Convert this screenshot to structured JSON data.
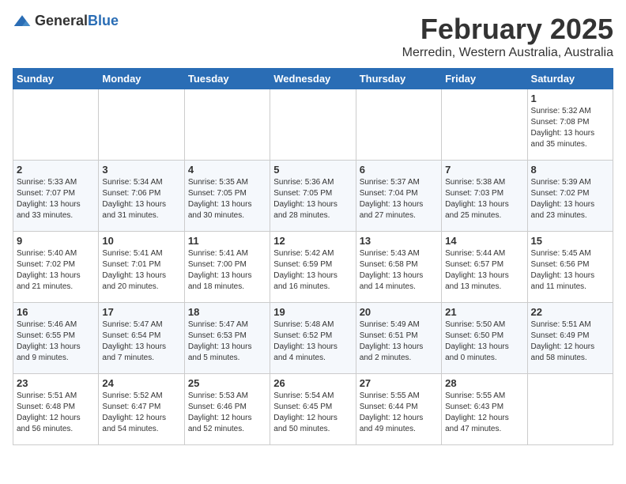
{
  "logo": {
    "text_general": "General",
    "text_blue": "Blue"
  },
  "title": "February 2025",
  "location": "Merredin, Western Australia, Australia",
  "headers": [
    "Sunday",
    "Monday",
    "Tuesday",
    "Wednesday",
    "Thursday",
    "Friday",
    "Saturday"
  ],
  "weeks": [
    [
      {
        "day": "",
        "info": ""
      },
      {
        "day": "",
        "info": ""
      },
      {
        "day": "",
        "info": ""
      },
      {
        "day": "",
        "info": ""
      },
      {
        "day": "",
        "info": ""
      },
      {
        "day": "",
        "info": ""
      },
      {
        "day": "1",
        "info": "Sunrise: 5:32 AM\nSunset: 7:08 PM\nDaylight: 13 hours and 35 minutes."
      }
    ],
    [
      {
        "day": "2",
        "info": "Sunrise: 5:33 AM\nSunset: 7:07 PM\nDaylight: 13 hours and 33 minutes."
      },
      {
        "day": "3",
        "info": "Sunrise: 5:34 AM\nSunset: 7:06 PM\nDaylight: 13 hours and 31 minutes."
      },
      {
        "day": "4",
        "info": "Sunrise: 5:35 AM\nSunset: 7:05 PM\nDaylight: 13 hours and 30 minutes."
      },
      {
        "day": "5",
        "info": "Sunrise: 5:36 AM\nSunset: 7:05 PM\nDaylight: 13 hours and 28 minutes."
      },
      {
        "day": "6",
        "info": "Sunrise: 5:37 AM\nSunset: 7:04 PM\nDaylight: 13 hours and 27 minutes."
      },
      {
        "day": "7",
        "info": "Sunrise: 5:38 AM\nSunset: 7:03 PM\nDaylight: 13 hours and 25 minutes."
      },
      {
        "day": "8",
        "info": "Sunrise: 5:39 AM\nSunset: 7:02 PM\nDaylight: 13 hours and 23 minutes."
      }
    ],
    [
      {
        "day": "9",
        "info": "Sunrise: 5:40 AM\nSunset: 7:02 PM\nDaylight: 13 hours and 21 minutes."
      },
      {
        "day": "10",
        "info": "Sunrise: 5:41 AM\nSunset: 7:01 PM\nDaylight: 13 hours and 20 minutes."
      },
      {
        "day": "11",
        "info": "Sunrise: 5:41 AM\nSunset: 7:00 PM\nDaylight: 13 hours and 18 minutes."
      },
      {
        "day": "12",
        "info": "Sunrise: 5:42 AM\nSunset: 6:59 PM\nDaylight: 13 hours and 16 minutes."
      },
      {
        "day": "13",
        "info": "Sunrise: 5:43 AM\nSunset: 6:58 PM\nDaylight: 13 hours and 14 minutes."
      },
      {
        "day": "14",
        "info": "Sunrise: 5:44 AM\nSunset: 6:57 PM\nDaylight: 13 hours and 13 minutes."
      },
      {
        "day": "15",
        "info": "Sunrise: 5:45 AM\nSunset: 6:56 PM\nDaylight: 13 hours and 11 minutes."
      }
    ],
    [
      {
        "day": "16",
        "info": "Sunrise: 5:46 AM\nSunset: 6:55 PM\nDaylight: 13 hours and 9 minutes."
      },
      {
        "day": "17",
        "info": "Sunrise: 5:47 AM\nSunset: 6:54 PM\nDaylight: 13 hours and 7 minutes."
      },
      {
        "day": "18",
        "info": "Sunrise: 5:47 AM\nSunset: 6:53 PM\nDaylight: 13 hours and 5 minutes."
      },
      {
        "day": "19",
        "info": "Sunrise: 5:48 AM\nSunset: 6:52 PM\nDaylight: 13 hours and 4 minutes."
      },
      {
        "day": "20",
        "info": "Sunrise: 5:49 AM\nSunset: 6:51 PM\nDaylight: 13 hours and 2 minutes."
      },
      {
        "day": "21",
        "info": "Sunrise: 5:50 AM\nSunset: 6:50 PM\nDaylight: 13 hours and 0 minutes."
      },
      {
        "day": "22",
        "info": "Sunrise: 5:51 AM\nSunset: 6:49 PM\nDaylight: 12 hours and 58 minutes."
      }
    ],
    [
      {
        "day": "23",
        "info": "Sunrise: 5:51 AM\nSunset: 6:48 PM\nDaylight: 12 hours and 56 minutes."
      },
      {
        "day": "24",
        "info": "Sunrise: 5:52 AM\nSunset: 6:47 PM\nDaylight: 12 hours and 54 minutes."
      },
      {
        "day": "25",
        "info": "Sunrise: 5:53 AM\nSunset: 6:46 PM\nDaylight: 12 hours and 52 minutes."
      },
      {
        "day": "26",
        "info": "Sunrise: 5:54 AM\nSunset: 6:45 PM\nDaylight: 12 hours and 50 minutes."
      },
      {
        "day": "27",
        "info": "Sunrise: 5:55 AM\nSunset: 6:44 PM\nDaylight: 12 hours and 49 minutes."
      },
      {
        "day": "28",
        "info": "Sunrise: 5:55 AM\nSunset: 6:43 PM\nDaylight: 12 hours and 47 minutes."
      },
      {
        "day": "",
        "info": ""
      }
    ]
  ]
}
